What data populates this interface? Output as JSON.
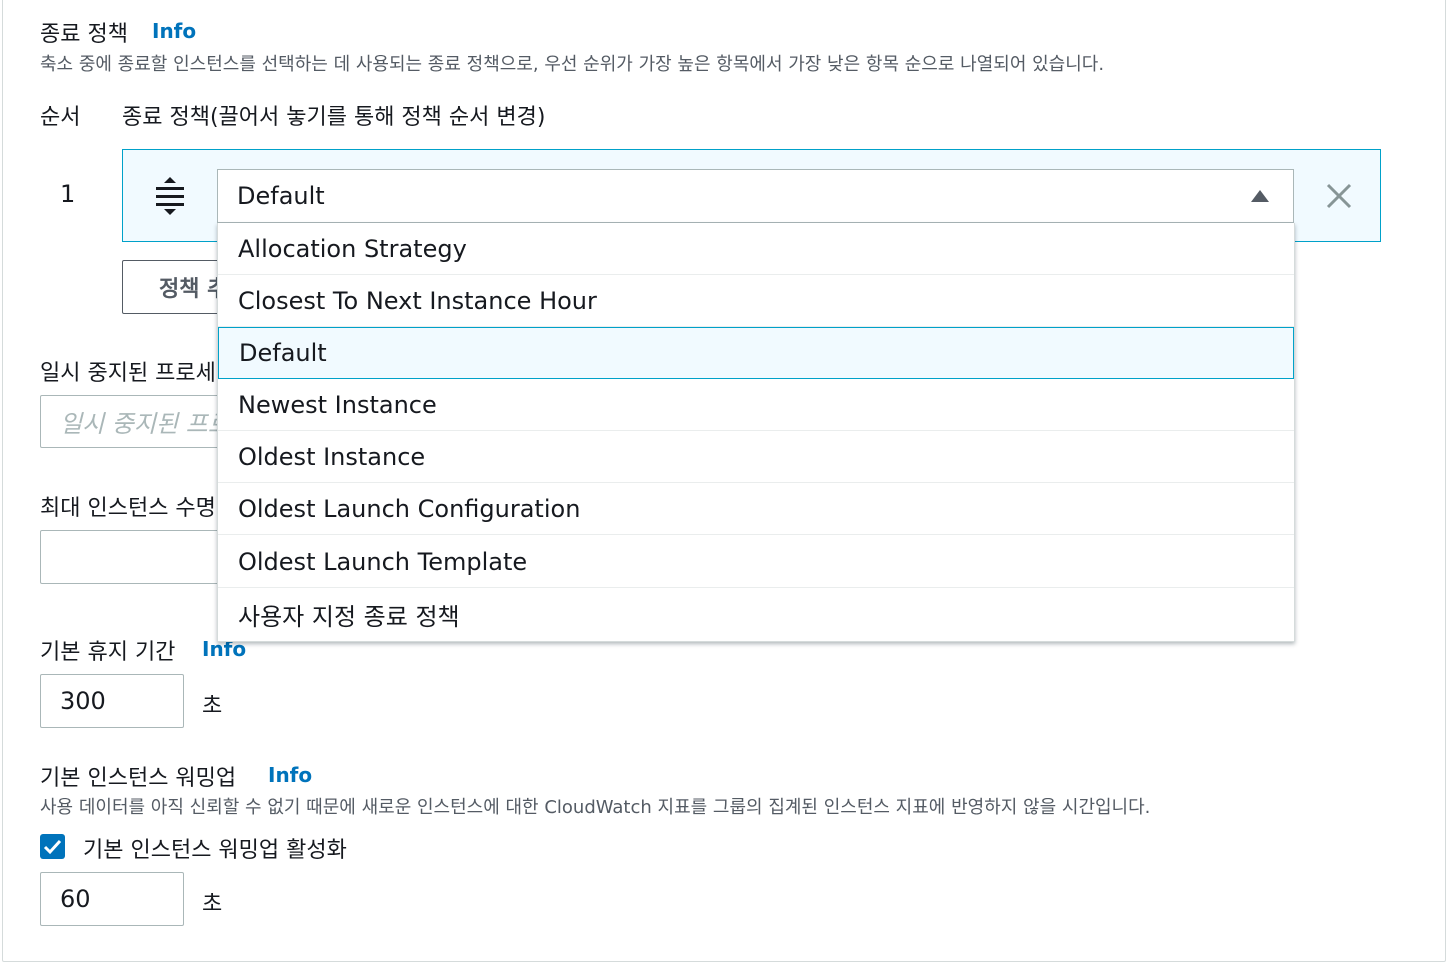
{
  "termination": {
    "title": "종료 정책",
    "info": "Info",
    "description": "축소 중에 종료할 인스턴스를 선택하는 데 사용되는 종료 정책으로, 우선 순위가 가장 높은 항목에서 가장 낮은 항목 순으로 나열되어 있습니다.",
    "order_header": "순서",
    "policy_header": "종료 정책(끌어서 놓기를 통해 정책 순서 변경)",
    "row_number": "1",
    "selected_value": "Default",
    "options": [
      "Allocation Strategy",
      "Closest To Next Instance Hour",
      "Default",
      "Newest Instance",
      "Oldest Instance",
      "Oldest Launch Configuration",
      "Oldest Launch Template",
      "사용자 지정 종료 정책"
    ],
    "add_button": "정책 추"
  },
  "suspended": {
    "label": "일시 중지된 프로세",
    "placeholder": "일시 중지된 프로"
  },
  "max_lifetime": {
    "label": "최대 인스턴스 수명",
    "value": ""
  },
  "cooldown": {
    "label": "기본 휴지 기간",
    "info": "Info",
    "value": "300",
    "unit": "초"
  },
  "warmup": {
    "label": "기본 인스턴스 워밍업",
    "info": "Info",
    "description": "사용 데이터를 아직 신뢰할 수 없기 때문에 새로운 인스턴스에 대한 CloudWatch 지표를 그룹의 집계된 인스턴스 지표에 반영하지 않을 시간입니다.",
    "checkbox_label": "기본 인스턴스 워밍업 활성화",
    "checked": true,
    "value": "60",
    "unit": "초"
  },
  "colors": {
    "accent": "#0073bb",
    "selected_bg": "#f1faff",
    "selected_border": "#00a1c9"
  }
}
